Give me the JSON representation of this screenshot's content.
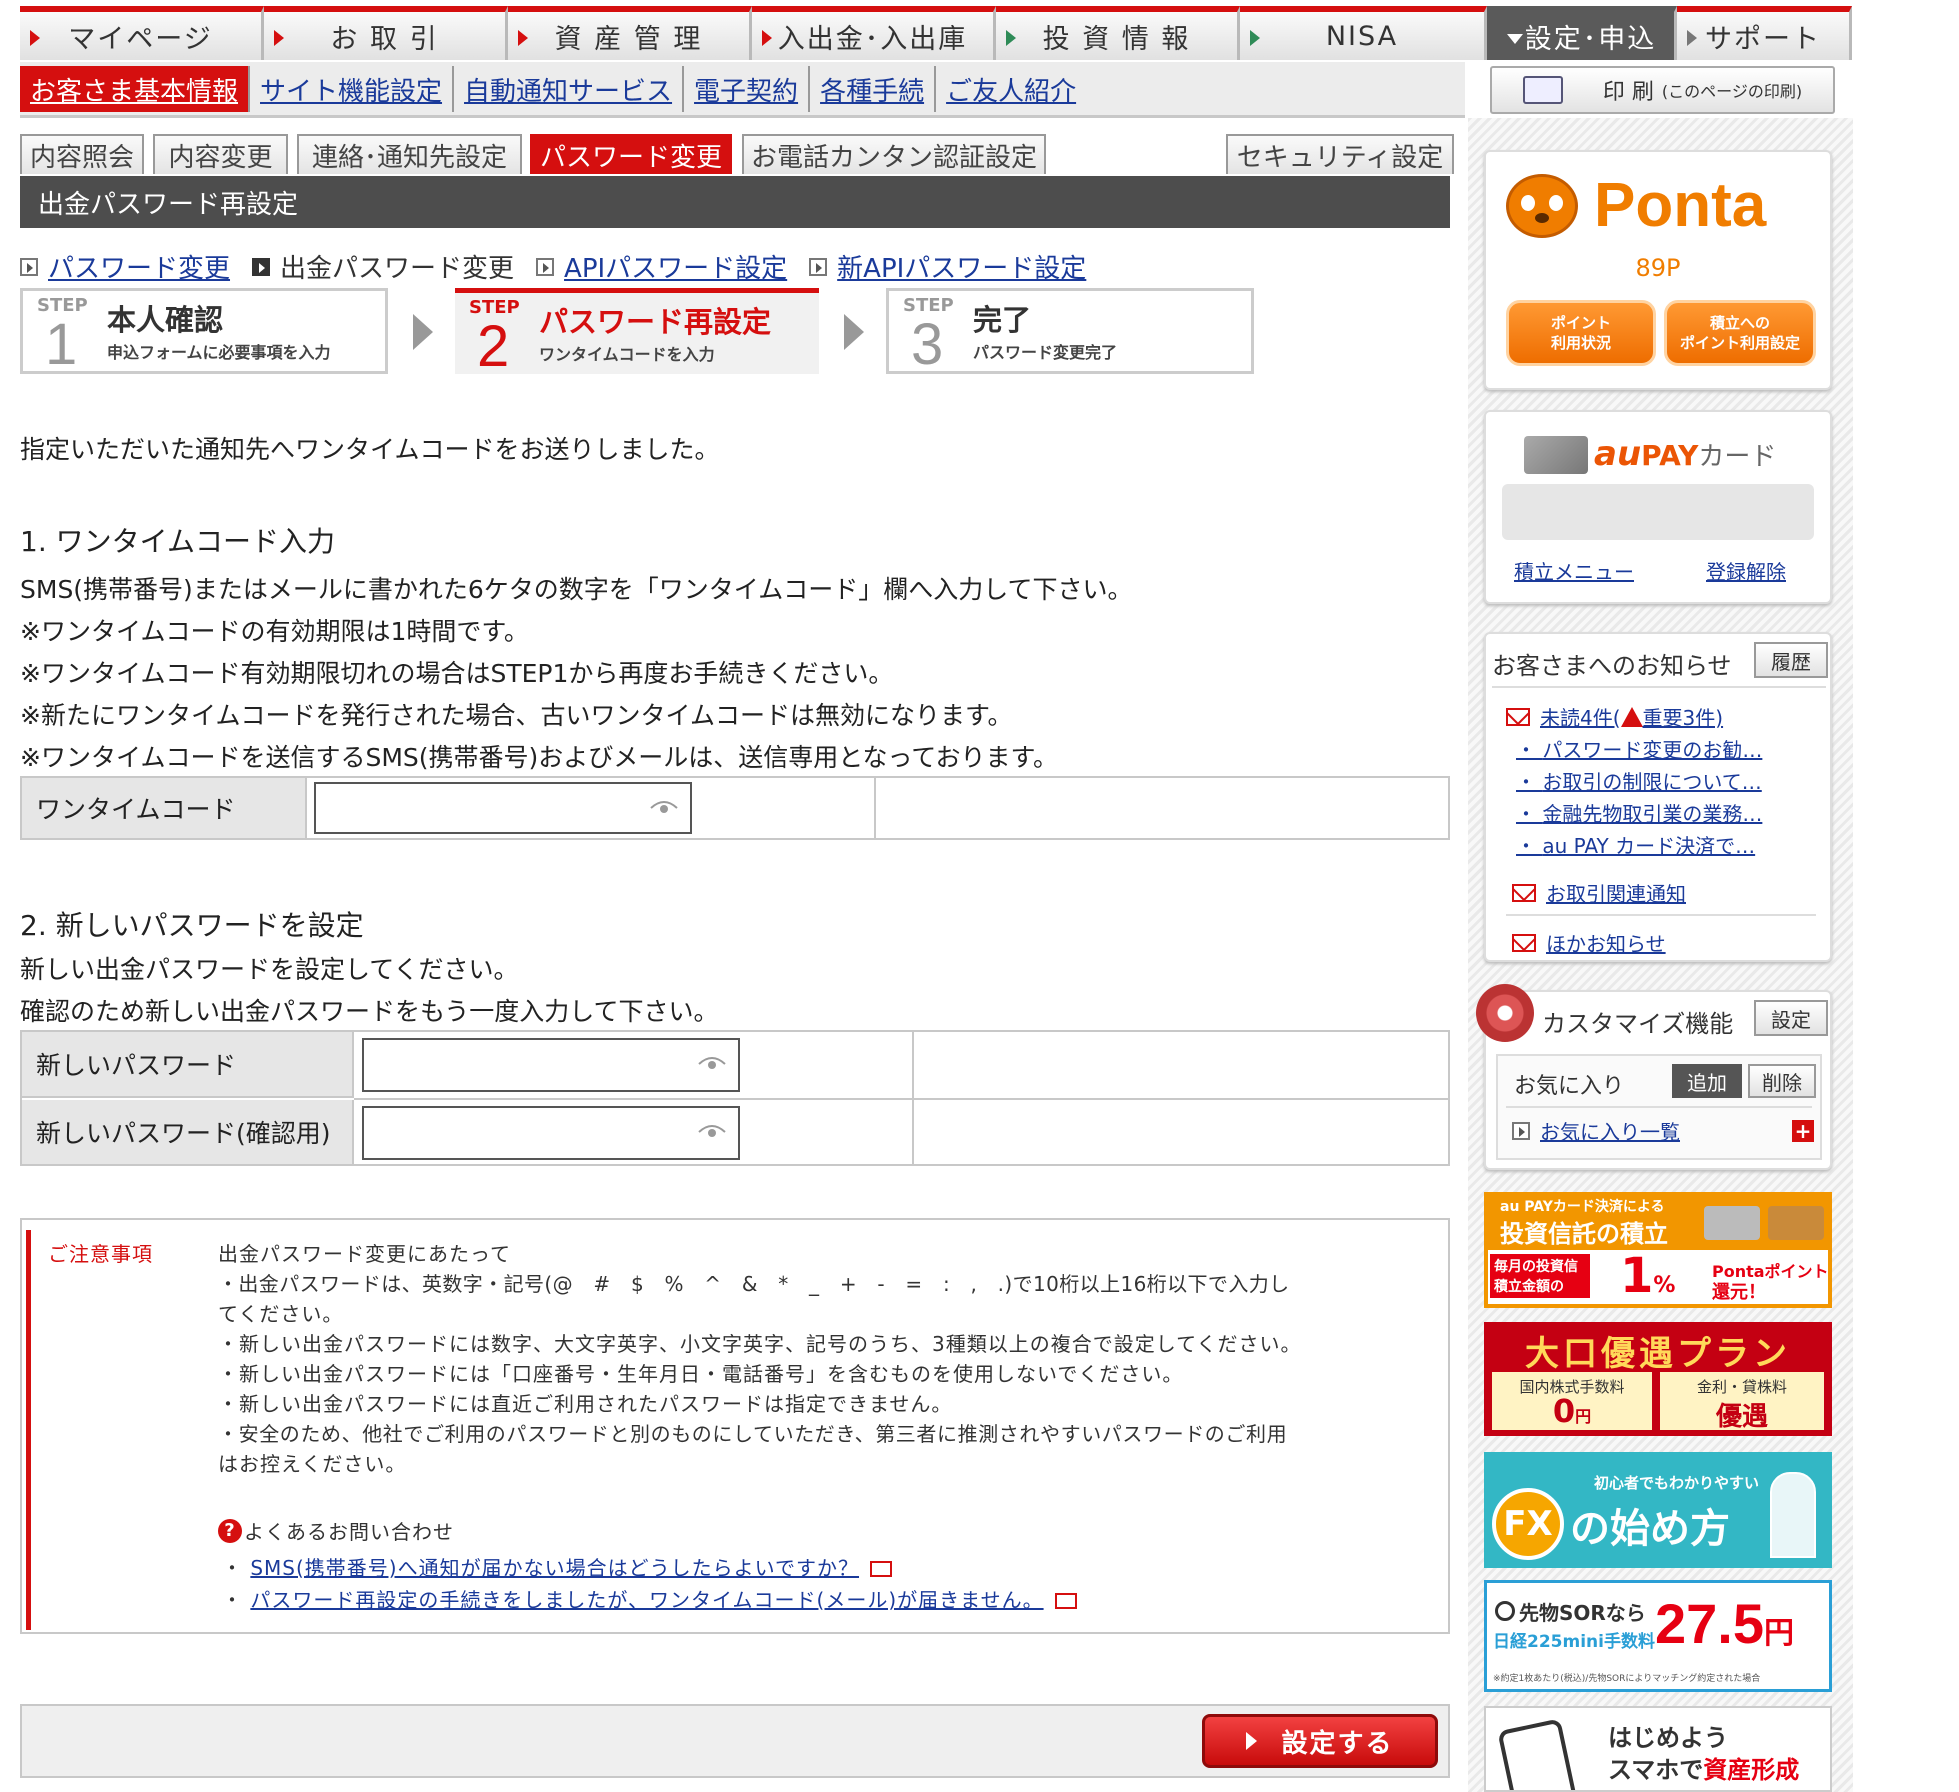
{
  "colors": {
    "accent": "#d50f0f",
    "link": "#1a3a9a",
    "section_bar": "#4d4d4d",
    "ponta_orange": "#f07d00"
  },
  "topnav": [
    "マイページ",
    "お 取 引",
    "資 産 管 理",
    "入出金･入出庫",
    "投 資 情 報",
    "NISA",
    "設定･申込",
    "サポート"
  ],
  "subnav": [
    "お客さま基本情報",
    "サイト機能設定",
    "自動通知サービス",
    "電子契約",
    "各種手続",
    "ご友人紹介"
  ],
  "print": {
    "label": "印 刷",
    "sub": "(このページの印刷)"
  },
  "pagetabs": [
    "内容照会",
    "内容変更",
    "連絡･通知先設定",
    "パスワード変更",
    "お電話カンタン認証設定",
    "セキュリティ設定"
  ],
  "section_title": "出金パスワード再設定",
  "links": [
    "パスワード変更",
    "出金パスワード変更",
    "APIパスワード設定",
    "新APIパスワード設定"
  ],
  "steps": [
    {
      "label": "STEP",
      "num": "1",
      "title": "本人確認",
      "sub": "申込フォームに必要事項を入力"
    },
    {
      "label": "STEP",
      "num": "2",
      "title": "パスワード再設定",
      "sub": "ワンタイムコードを入力"
    },
    {
      "label": "STEP",
      "num": "3",
      "title": "完了",
      "sub": "パスワード変更完了"
    }
  ],
  "intro": "指定いただいた通知先へワンタイムコードをお送りしました。",
  "sec1": {
    "heading": "1. ワンタイムコード入力",
    "lines": [
      "SMS(携帯番号)またはメールに書かれた6ケタの数字を「ワンタイムコード」欄へ入力して下さい。",
      "※ワンタイムコードの有効期限は1時間です。",
      "※ワンタイムコード有効期限切れの場合はSTEP1から再度お手続きください。",
      "※新たにワンタイムコードを発行された場合、古いワンタイムコードは無効になります。",
      "※ワンタイムコードを送信するSMS(携帯番号)およびメールは、送信専用となっております。"
    ],
    "field_label": "ワンタイムコード",
    "field_value": ""
  },
  "sec2": {
    "heading": "2. 新しいパスワードを設定",
    "lines": [
      "新しい出金パスワードを設定してください。",
      "確認のため新しい出金パスワードをもう一度入力して下さい。"
    ],
    "field1_label": "新しいパスワード",
    "field2_label": "新しいパスワード(確認用)",
    "field1_value": "",
    "field2_value": ""
  },
  "notice": {
    "title": "ご注意事項",
    "lines": [
      "出金パスワード変更にあたって",
      "・出金パスワードは、英数字・記号(@　#　$　%　^　&　*　_　+　-　=　:　,　.)で10桁以上16桁以下で入力し",
      "てください。",
      "・新しい出金パスワードには数字、大文字英字、小文字英字、記号のうち、3種類以上の複合で設定してください。",
      "・新しい出金パスワードには「口座番号・生年月日・電話番号」を含むものを使用しないでください。",
      "・新しい出金パスワードには直近ご利用されたパスワードは指定できません。",
      "・安全のため、他社でご利用のパスワードと別のものにしていただき、第三者に推測されやすいパスワードのご利用",
      "はお控えください。"
    ],
    "faq_title": "よくあるお問い合わせ",
    "faq": [
      "SMS(携帯番号)へ通知が届かない場合はどうしたらよいですか？",
      "パスワード再設定の手続きをしましたが、ワンタイムコード(メール)が届きません。"
    ]
  },
  "submit": "設定する",
  "sidebar": {
    "ponta": {
      "logo": "Ponta",
      "points": "89P",
      "btn1": [
        "ポイント",
        "利用状況"
      ],
      "btn2": [
        "積立への",
        "ポイント利用設定"
      ]
    },
    "aupay": {
      "logo_au": "au",
      "logo_pay": "PAY",
      "logo_card": "カード",
      "link1": "積立メニュー",
      "link2": "登録解除"
    },
    "news": {
      "title": "お客さまへのお知らせ",
      "history": "履歴",
      "unread": "未読4件(",
      "important": "重要3件)",
      "items": [
        "パスワード変更のお勧…",
        "お取引の制限について…",
        "金融先物取引業の業務…",
        "au PAY カード決済で…"
      ],
      "trade": "お取引関連通知",
      "other": "ほかお知らせ"
    },
    "custom": {
      "title": "カスタマイズ機能",
      "setting": "設定",
      "fav": "お気に入り",
      "add": "追加",
      "del": "削除",
      "list": "お気に入り一覧"
    },
    "banners": {
      "b1": {
        "l1": "au PAYカード決済による",
        "l2": "投資信託の積立",
        "l3": "毎月の投資信託",
        "l4": "積立金額の",
        "pct": "1",
        "pctunit": "%",
        "l5": "Pontaポイント",
        "l6": "還元！"
      },
      "b2": {
        "title": "大口優遇プラン",
        "c1": "国内株式手数料",
        "v1": "0",
        "v1u": "円",
        "c2": "金利・貸株料",
        "v2": "優遇"
      },
      "b3": {
        "sub": "初心者でもわかりやすい",
        "fx": "FX",
        "rest": "の始め方"
      },
      "b4": {
        "l1": "先物SORなら",
        "l2": "日経225mini手数料",
        "price": "27.5",
        "unit": "円",
        "note": "※約定1枚あたり(税込)/先物SORによりマッチング約定された場合"
      },
      "b5": {
        "l1": "はじめよう",
        "l2": "スマホで",
        "l3": "資産形成"
      }
    }
  }
}
